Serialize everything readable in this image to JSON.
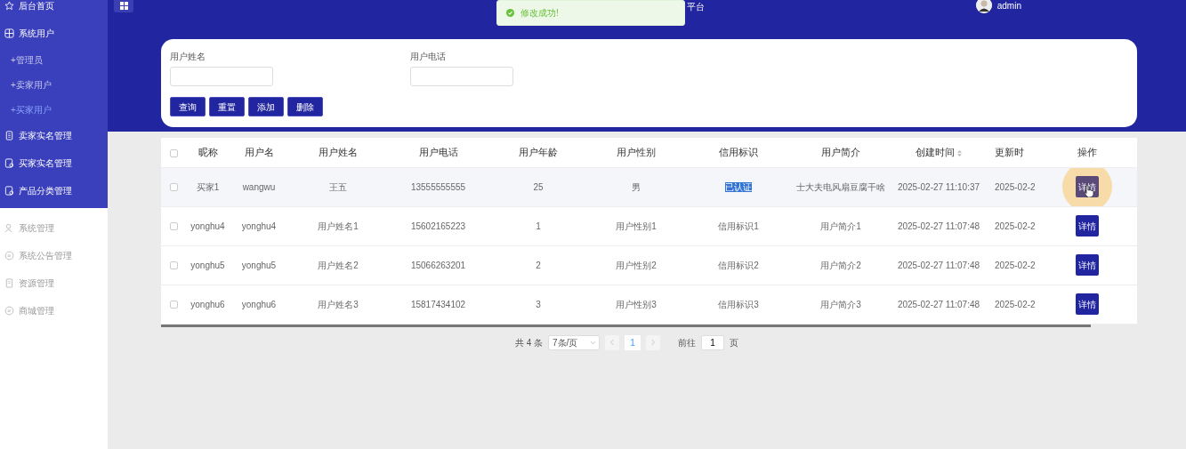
{
  "header": {
    "title": "平台",
    "user": "admin"
  },
  "toast": {
    "message": "修改成功!",
    "kind": "success"
  },
  "sidebar": {
    "items": [
      {
        "label": "后台首页",
        "kind": "main",
        "selected": false
      },
      {
        "label": "系统用户",
        "kind": "main",
        "selected": false,
        "children": [
          {
            "label": "+管理员",
            "selected": false
          },
          {
            "label": "+卖家用户",
            "selected": false
          },
          {
            "label": "+买家用户",
            "selected": true
          }
        ]
      },
      {
        "label": "卖家实名管理",
        "kind": "main",
        "selected": false
      },
      {
        "label": "买家实名管理",
        "kind": "main",
        "selected": false
      },
      {
        "label": "产品分类管理",
        "kind": "main",
        "selected": false
      },
      {
        "label": "系统管理",
        "kind": "other",
        "selected": false
      },
      {
        "label": "系统公告管理",
        "kind": "other",
        "selected": false
      },
      {
        "label": "资源管理",
        "kind": "other",
        "selected": false
      },
      {
        "label": "商城管理",
        "kind": "other",
        "selected": false
      }
    ]
  },
  "search": {
    "fields": [
      {
        "label": "用户姓名"
      },
      {
        "label": "用户电话"
      }
    ],
    "buttons": [
      "查询",
      "重置",
      "添加",
      "删除"
    ]
  },
  "table": {
    "select_all_checked": false,
    "columns": [
      {
        "label": "昵称",
        "sortable": false
      },
      {
        "label": "用户名",
        "sortable": false
      },
      {
        "label": "用户姓名",
        "sortable": false
      },
      {
        "label": "用户电话",
        "sortable": false
      },
      {
        "label": "用户年龄",
        "sortable": false
      },
      {
        "label": "用户性别",
        "sortable": false
      },
      {
        "label": "信用标识",
        "sortable": false
      },
      {
        "label": "用户简介",
        "sortable": false
      },
      {
        "label": "创建时间",
        "sortable": true
      },
      {
        "label": "更新时",
        "sortable": false
      },
      {
        "label": "操作",
        "sortable": false
      }
    ],
    "rows": [
      {
        "checked": false,
        "hovered": true,
        "credit_text_selected": true,
        "cells": [
          "买家1",
          "wangwu",
          "王五",
          "13555555555",
          "25",
          "男",
          "已认证",
          "士大夫电风扇豆腐干啥",
          "2025-02-27 11:10:37",
          "2025-02-2"
        ],
        "action": "详情"
      },
      {
        "checked": false,
        "hovered": false,
        "credit_text_selected": false,
        "cells": [
          "yonghu4",
          "yonghu4",
          "用户姓名1",
          "15602165223",
          "1",
          "用户性别1",
          "信用标识1",
          "用户简介1",
          "2025-02-27 11:07:48",
          "2025-02-2"
        ],
        "action": "详情"
      },
      {
        "checked": false,
        "hovered": false,
        "credit_text_selected": false,
        "cells": [
          "yonghu5",
          "yonghu5",
          "用户姓名2",
          "15066263201",
          "2",
          "用户性别2",
          "信用标识2",
          "用户简介2",
          "2025-02-27 11:07:48",
          "2025-02-2"
        ],
        "action": "详情"
      },
      {
        "checked": false,
        "hovered": false,
        "credit_text_selected": false,
        "cells": [
          "yonghu6",
          "yonghu6",
          "用户姓名3",
          "15817434102",
          "3",
          "用户性别3",
          "信用标识3",
          "用户简介3",
          "2025-02-27 11:07:48",
          "2025-02-2"
        ],
        "action": "详情"
      }
    ]
  },
  "pagination": {
    "total": "共 4 条",
    "page_size": "7条/页",
    "pages": [
      {
        "label": "1",
        "selected": true
      }
    ],
    "goto_label": "前往",
    "goto_value": "1",
    "goto_suffix": "页"
  }
}
